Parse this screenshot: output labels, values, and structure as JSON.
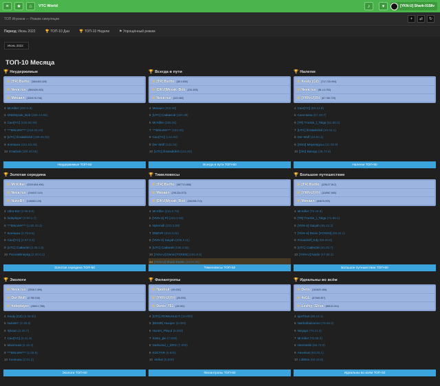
{
  "nav": {
    "brand": "VTC World",
    "user": "[YKN-U] Shark-0158v",
    "menu_icon": "menu-icon",
    "star_icon": "star-icon",
    "bell_icon": "bell-icon"
  },
  "subbar": {
    "title": "ТОП Игроков — Режим симуляции"
  },
  "filters": {
    "period_label": "Период:",
    "period_value": "Июнь 2022",
    "top_days": "ТОП-10 Дни",
    "top_weeks": "ТОП-10 Недели",
    "compact_mode": "Упрощённый режим"
  },
  "month_select": {
    "value": "Июнь 2022"
  },
  "heading": "ТОП-10 Месяца",
  "colors": {
    "accent_green": "#4cb44c",
    "button_blue": "#3ba4dc",
    "podium_blue": "#9cb5e0",
    "link_blue": "#2d85c4",
    "gold": "#f1c232"
  },
  "cards": [
    {
      "title": "Неудержимые",
      "podium": [
        {
          "name": "[TR] Burho",
          "value": "(384/453.428)"
        },
        {
          "name": "Neva rus",
          "value": "(384/429.403)"
        },
        {
          "name": "Михаил",
          "value": "(320/178.746)"
        }
      ],
      "list": [
        {
          "rank": "4",
          "name": "Mr.Killer",
          "value": "(300.9.8)"
        },
        {
          "name": "DNEMysak_Bob",
          "value": "(258.14.88)",
          "rank": "5"
        },
        {
          "name": "Caxr[YC]",
          "value": "(245.80.59)",
          "rank": "6"
        },
        {
          "name": "***BNLWH***",
          "value": "(218.40.19)",
          "rank": "7"
        },
        {
          "name": "[UTC] Ёлквкйгйгй",
          "value": "(188.46.83)",
          "rank": "8"
        },
        {
          "name": "Коняшка",
          "value": "(151.63.48)",
          "rank": "9"
        },
        {
          "name": "Юзвбой",
          "value": "(152.40.06)",
          "rank": "10"
        }
      ],
      "button": "Неудержимые ТОП-50"
    },
    {
      "title": "Всегда в пути",
      "podium": [
        {
          "name": "[TR] Burho",
          "value": "(38 4.836)"
        },
        {
          "name": "[DKU]Mysak_Bob",
          "value": "(231.828)"
        },
        {
          "name": "Neva rus",
          "value": "(222.060)"
        }
      ],
      "list": [
        {
          "rank": "4",
          "name": "Михаил",
          "value": "(203.40)"
        },
        {
          "name": "[UTC] Сайвикэй",
          "value": "(190.38)",
          "rank": "5"
        },
        {
          "name": "Mr.Killer",
          "value": "(166.35)",
          "rank": "6"
        },
        {
          "name": "***BNLWH***",
          "value": "(150.30)",
          "rank": "7"
        },
        {
          "name": "Caxr[YC]",
          "value": "(141.60)",
          "rank": "8"
        },
        {
          "name": "Der Wolf",
          "value": "(132.34)",
          "rank": "9"
        },
        {
          "name": "[UTC] Ёлквкйгйгй",
          "value": "(121.60)",
          "rank": "10"
        }
      ],
      "button": "Всегда в пути ТОП-50"
    },
    {
      "title": "Налегке",
      "podium": [
        {
          "name": "Keuty (CZ)",
          "value": "(717.720.994)"
        },
        {
          "name": "Neva rus",
          "value": "(81.14.753)"
        },
        {
          "name": "[YKN-U] Fil",
          "value": "(67.780.729)"
        }
      ],
      "list": [
        {
          "rank": "4",
          "name": "Caxr[YC]",
          "value": "(60.12.8)"
        },
        {
          "name": "Cass-вана",
          "value": "(57.49.7)",
          "rank": "5"
        },
        {
          "name": "[TR] Truckin_l_Tolga",
          "value": "(51.88.3)",
          "rank": "6"
        },
        {
          "name": "[UTC] Ёлквкйгйгй",
          "value": "(46.04.1)",
          "rank": "7"
        },
        {
          "name": "Der Wolf",
          "value": "(44.50.1)",
          "rank": "8"
        },
        {
          "name": "[ОМЗ] Мяукевдсьз",
          "value": "(41.08.9)",
          "rank": "9"
        },
        {
          "name": "[DKI] Бвокур",
          "value": "(38.72.6)",
          "rank": "10"
        }
      ],
      "button": "Налегке ТОП-50"
    },
    {
      "title": "Золотая середина",
      "podium": [
        {
          "name": "Mr.Killer",
          "value": "(2029.604.406)"
        },
        {
          "name": "Neva rus",
          "value": "(194037.119)"
        },
        {
          "name": "NukeBY",
          "value": "(136583.129)"
        }
      ],
      "list": [
        {
          "rank": "4",
          "name": "Ultra-Bot",
          "value": "(2.98.6.6)"
        },
        {
          "name": "hideplayer",
          "value": "(2.90.1.7)",
          "rank": "5"
        },
        {
          "name": "***BNLWH***",
          "value": "(2.80.33.2)",
          "rank": "6"
        },
        {
          "name": "Коняшка",
          "value": "(2.79.8.6)",
          "rank": "7"
        },
        {
          "name": "Caxr[YC]",
          "value": "(2.67.3.3)",
          "rank": "8"
        },
        {
          "name": "[UTC] СайвкЭй",
          "value": "(2.45.1.5)",
          "rank": "9"
        },
        {
          "name": "РоссияВперёд",
          "value": "(2.40.0.1)",
          "rank": "10"
        }
      ],
      "button": "Золотая середина ТОП-50"
    },
    {
      "title": "Тяжеловесы",
      "podium": [
        {
          "name": "[TR] Burho",
          "value": "(367713.888)"
        },
        {
          "name": "Михаил",
          "value": "(291334.073)"
        },
        {
          "name": "[DKU]Mysak_Bob",
          "value": "(264396.713)"
        }
      ],
      "list": [
        {
          "rank": "4",
          "name": "Mr.Killer",
          "value": "(241.0.79)"
        },
        {
          "name": "[YKN-U] Fil",
          "value": "(233.2.94)",
          "rank": "5"
        },
        {
          "name": "Nykenidl",
          "value": "(220.3.59)",
          "rank": "6"
        },
        {
          "name": "DNEVR",
          "value": "(214.3.04)",
          "rank": "7"
        },
        {
          "name": "[YKN-U] Saiyah",
          "value": "(206.2.11)",
          "rank": "8"
        },
        {
          "name": "[UTC] Сайвкэй",
          "value": "(198.3.55)",
          "rank": "9"
        },
        {
          "name": "[YKN-U] Denis [YCKEN]",
          "value": "(191.8.6)",
          "rank": "10"
        },
        {
          "name": "[YKN-U] Shark-0158v",
          "value": "(123.5.95)",
          "rank": "44"
        }
      ],
      "button": "Тяжеловесы ТОП-50"
    },
    {
      "title": "Большое путешествие",
      "podium": [
        {
          "name": "[TR] Burho",
          "value": "(228127.812)"
        },
        {
          "name": "[YKN-U] Fil",
          "value": "(118967.665)"
        },
        {
          "name": "Михаил",
          "value": "(84678.939)"
        }
      ],
      "list": [
        {
          "rank": "4",
          "name": "Mr.Killer",
          "value": "(76.44.8)"
        },
        {
          "name": "[TR] Truckin_l_Tolga",
          "value": "(71.88.1)",
          "rank": "5"
        },
        {
          "name": "[YKN-U] Saiyah",
          "value": "(65.12.2)",
          "rank": "6"
        },
        {
          "name": "[YKN-U] Denis [YCKEN]",
          "value": "(59.32.1)",
          "rank": "7"
        },
        {
          "name": "Feoaaln2f_Kdy",
          "value": "(55.60.8)",
          "rank": "8"
        },
        {
          "name": "[UTC] СайвкЭй",
          "value": "(51.03.7)",
          "rank": "9"
        },
        {
          "name": "[YKN-U] Nadin",
          "value": "(47.88.2)",
          "rank": "10"
        }
      ],
      "button": "Большое путешествие ТОП-50"
    },
    {
      "title": "Экологи",
      "podium": [
        {
          "name": "Neva rus",
          "value": "(2538.0.365)"
        },
        {
          "name": "Der Wolf",
          "value": "(2.780.516)"
        },
        {
          "name": "hideplayer",
          "value": "(2890.1.788)"
        }
      ],
      "list": [
        {
          "rank": "4",
          "name": "Keuty (CZ)",
          "value": "(2.44.31)"
        },
        {
          "name": "NukeBY",
          "value": "(2.38.9)",
          "rank": "5"
        },
        {
          "name": "Ilykson",
          "value": "(2.30.7)",
          "rank": "6"
        },
        {
          "name": "Caxr[YC]",
          "value": "(2.21.5)",
          "rank": "7"
        },
        {
          "name": "Maximuss",
          "value": "(2.15.3)",
          "rank": "8"
        },
        {
          "name": "***BNLWH***",
          "value": "(2.08.8)",
          "rank": "9"
        },
        {
          "name": "Коняшка",
          "value": "(2.01.2)",
          "rank": "10"
        }
      ],
      "button": "Экологи ТОП-50"
    },
    {
      "title": "Филантропы",
      "podium": [
        {
          "name": "Пробой",
          "value": "(00.000)"
        },
        {
          "name": "[YKN-U] Fil",
          "value": "(25.000)"
        },
        {
          "name": "Denis_761",
          "value": "(15.000)"
        }
      ],
      "list": [
        {
          "rank": "4",
          "name": "[UTC] ROMUALD.T",
          "value": "(10.000)"
        },
        {
          "name": "[BKMR] Ньюрег",
          "value": "(9.000)",
          "rank": "5"
        },
        {
          "name": "Hunter_Play.d",
          "value": "(8.000)",
          "rank": "6"
        },
        {
          "name": "Kinito_pie",
          "value": "(7.500)",
          "rank": "7"
        },
        {
          "name": "Darkwind_I_ERG",
          "value": "(7.000)",
          "rank": "8"
        },
        {
          "name": "KDCTAR",
          "value": "(6.500)",
          "rank": "9"
        },
        {
          "name": "Alefun",
          "value": "(6.000)",
          "rank": "10"
        }
      ],
      "button": "Филантропы ТОП-50"
    },
    {
      "title": "Идеальны во всём",
      "podium": [
        {
          "name": "Denn",
          "value": "(102820.466)"
        },
        {
          "name": "4sGL",
          "value": "(87466.907)"
        },
        {
          "name": "Leshiy_32rus",
          "value": "(85140.914)"
        }
      ],
      "list": [
        {
          "rank": "4",
          "name": "igorTirus",
          "value": "(80.12.1)"
        },
        {
          "name": "Nakfubbalvanno",
          "value": "(78.66.5)",
          "rank": "5"
        },
        {
          "name": "Ninjago",
          "value": "(74.31.2)",
          "rank": "6"
        },
        {
          "name": "Mr.Killer",
          "value": "(70.05.3)",
          "rank": "7"
        },
        {
          "name": "Heerstelin",
          "value": "(66.72.8)",
          "rank": "8"
        },
        {
          "name": "Alexelusi",
          "value": "(63.40.1)",
          "rank": "9"
        },
        {
          "name": "LitiWoo",
          "value": "(60.18.6)",
          "rank": "10"
        }
      ],
      "button": "Идеальны во всём ТОП-50"
    }
  ]
}
